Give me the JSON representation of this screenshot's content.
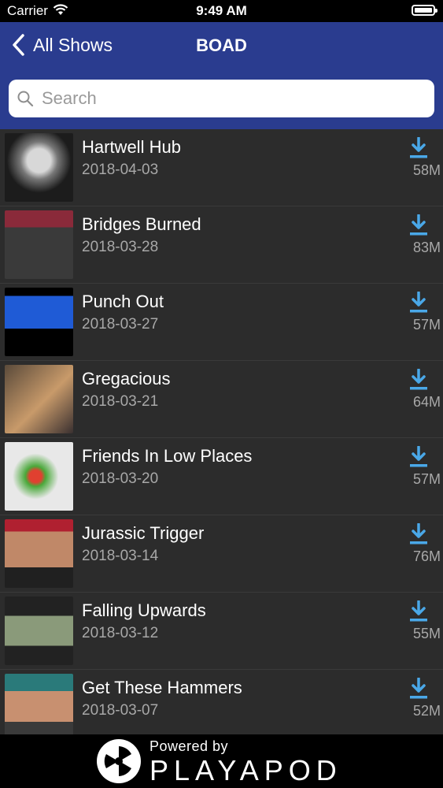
{
  "status_bar": {
    "carrier": "Carrier",
    "time": "9:49 AM"
  },
  "nav": {
    "back_label": "All Shows",
    "title": "BOAD"
  },
  "search": {
    "placeholder": "Search"
  },
  "episodes": [
    {
      "title": "Hartwell Hub",
      "date": "2018-04-03",
      "size": "58M"
    },
    {
      "title": "Bridges Burned",
      "date": "2018-03-28",
      "size": "83M"
    },
    {
      "title": "Punch Out",
      "date": "2018-03-27",
      "size": "57M"
    },
    {
      "title": "Gregacious",
      "date": "2018-03-21",
      "size": "64M"
    },
    {
      "title": "Friends In Low Places",
      "date": "2018-03-20",
      "size": "57M"
    },
    {
      "title": "Jurassic Trigger",
      "date": "2018-03-14",
      "size": "76M"
    },
    {
      "title": "Falling Upwards",
      "date": "2018-03-12",
      "size": "55M"
    },
    {
      "title": "Get These Hammers",
      "date": "2018-03-07",
      "size": "52M"
    }
  ],
  "footer": {
    "powered_by": "Powered by",
    "brand": "PLAYAPOD"
  },
  "colors": {
    "nav_bg": "#2a3c8f",
    "list_bg": "#2c2c2c",
    "download_icon": "#4aa8e8"
  },
  "icons": {
    "back": "chevron-left-icon",
    "search": "magnifier-icon",
    "download": "download-arrow-icon",
    "logo": "reel-icon"
  }
}
